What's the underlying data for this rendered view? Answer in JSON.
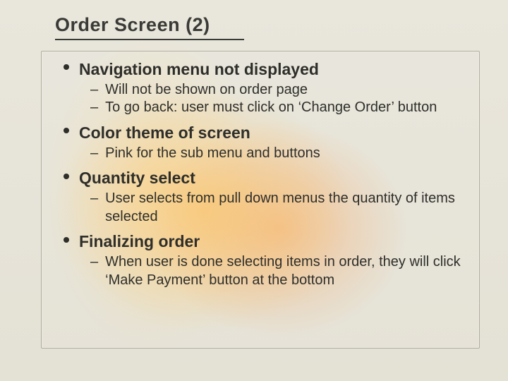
{
  "title": "Order Screen (2)",
  "bullets": [
    {
      "heading": "Navigation menu not displayed",
      "subs": [
        "Will not be shown on order page",
        "To go back: user must click on ‘Change Order’ button"
      ]
    },
    {
      "heading": "Color theme of screen",
      "subs": [
        "Pink for the sub menu and buttons"
      ]
    },
    {
      "heading": "Quantity select",
      "subs": [
        "User selects from pull down menus the quantity of items selected"
      ]
    },
    {
      "heading": "Finalizing order",
      "subs": [
        "When user is done selecting items in order, they will click ‘Make Payment’ button at the bottom"
      ]
    }
  ]
}
